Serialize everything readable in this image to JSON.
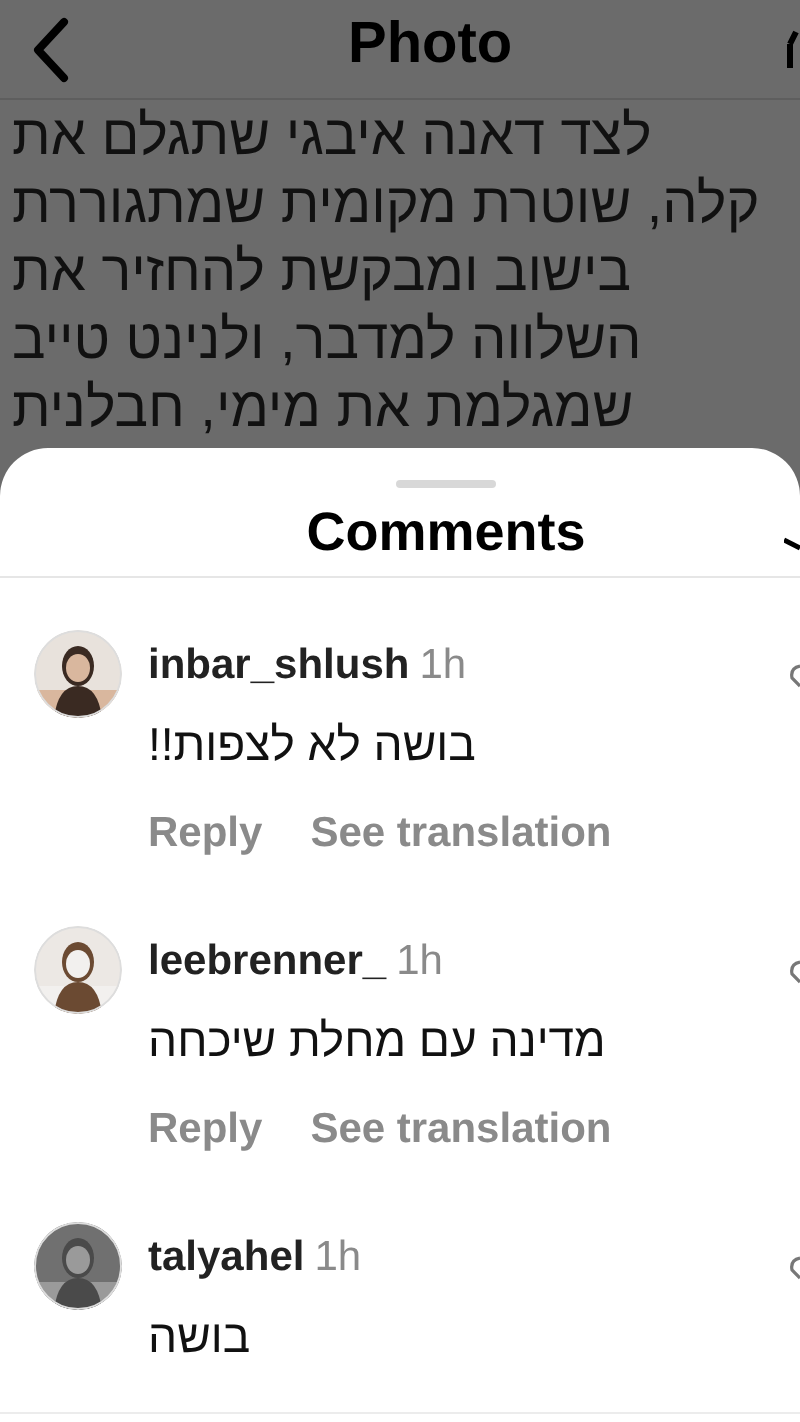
{
  "header": {
    "title": "Photo"
  },
  "caption_lines": [
    "לצד דאנה איבגי שתגלם את",
    "קלה, שוטרת מקומית שמתגוררת",
    "בישוב ומבקשת להחזיר את",
    "השלווה למדבר, ולנינט טייב",
    "שמגלמת את מימי, חבלנית"
  ],
  "sheet": {
    "title": "Comments"
  },
  "comments": [
    {
      "username": "inbar_shlush",
      "time": "1h",
      "text": "בושה לא לצפות!!",
      "actions": {
        "reply": "Reply",
        "translate": "See translation"
      }
    },
    {
      "username": "leebrenner_",
      "time": "1h",
      "text": "מדינה עם מחלת שיכחה",
      "actions": {
        "reply": "Reply",
        "translate": "See translation"
      }
    },
    {
      "username": "talyahel",
      "time": "1h",
      "text": "בושה"
    }
  ]
}
